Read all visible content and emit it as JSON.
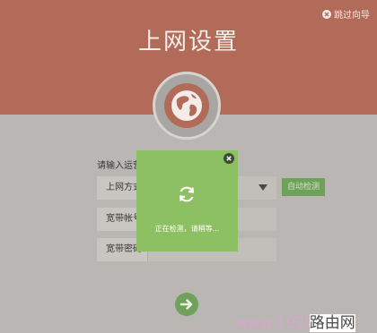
{
  "header": {
    "title": "上网设置",
    "skip_label": "跳过向导"
  },
  "form": {
    "prompt": "请输入运营",
    "connection_type_label": "上网方式",
    "account_label": "宽带帐号",
    "password_label": "宽带密码",
    "auto_detect_label": "自动检测"
  },
  "modal": {
    "message": "正在检测，请稍等..."
  },
  "watermark": {
    "url": "www.192l",
    "name": "路由网"
  },
  "colors": {
    "header": "#b26a59",
    "modal": "#8dc063",
    "button": "#6fa15a",
    "overlay": "#b9b6b3"
  },
  "icons": {
    "skip": "close-circle-icon",
    "globe": "globe-icon",
    "spinner": "refresh-icon",
    "modal_close": "close-circle-icon",
    "next": "arrow-right-icon"
  }
}
